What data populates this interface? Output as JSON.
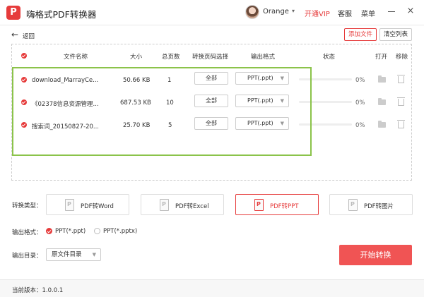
{
  "app": {
    "logo_text": "P",
    "title": "嗨格式PDF转换器",
    "user": {
      "name": "Orange"
    },
    "vip_label": "开通VIP",
    "service_label": "客服",
    "menu_label": "菜单",
    "minimize_label": "",
    "close_label": "×"
  },
  "toolbar": {
    "back_icon": "←",
    "back_label": "返回",
    "add_file_label": "添加文件",
    "clear_list_label": "清空列表"
  },
  "table": {
    "columns": {
      "name": "文件名称",
      "size": "大小",
      "pages": "总页数",
      "range": "转换页码选择",
      "format": "输出格式",
      "status": "状态",
      "open": "打开",
      "remove": "移除"
    },
    "rows": [
      {
        "name": "download_MarrayCe...",
        "size": "50.66 KB",
        "pages": "1",
        "range": "全部",
        "format": "PPT(.ppt)",
        "progress": "0%",
        "progress_fraction": 0
      },
      {
        "name": "《02378信息资源管理...",
        "size": "687.53 KB",
        "pages": "10",
        "range": "全部",
        "format": "PPT(.ppt)",
        "progress": "0%",
        "progress_fraction": 0
      },
      {
        "name": "搜索词_20150827-20...",
        "size": "25.70 KB",
        "pages": "5",
        "range": "全部",
        "format": "PPT(.ppt)",
        "progress": "0%",
        "progress_fraction": 0
      }
    ]
  },
  "conversion": {
    "type_label": "转换类型：",
    "types": [
      {
        "label": "PDF转Word",
        "active": false
      },
      {
        "label": "PDF转Excel",
        "active": false
      },
      {
        "label": "PDF转PPT",
        "active": true
      },
      {
        "label": "PDF转图片",
        "active": false
      }
    ],
    "output_format_label": "输出格式：",
    "formats": [
      {
        "label": "PPT(*.ppt)",
        "selected": true
      },
      {
        "label": "PPT(*.pptx)",
        "selected": false
      }
    ],
    "output_dir_label": "输出目录：",
    "output_dir_value": "原文件目录",
    "start_label": "开始转换"
  },
  "footer": {
    "version_label": "当前版本：1.0.0.1"
  },
  "colors": {
    "accent": "#e63b3b",
    "start_button": "#f05454",
    "highlight": "#8bc34a"
  }
}
